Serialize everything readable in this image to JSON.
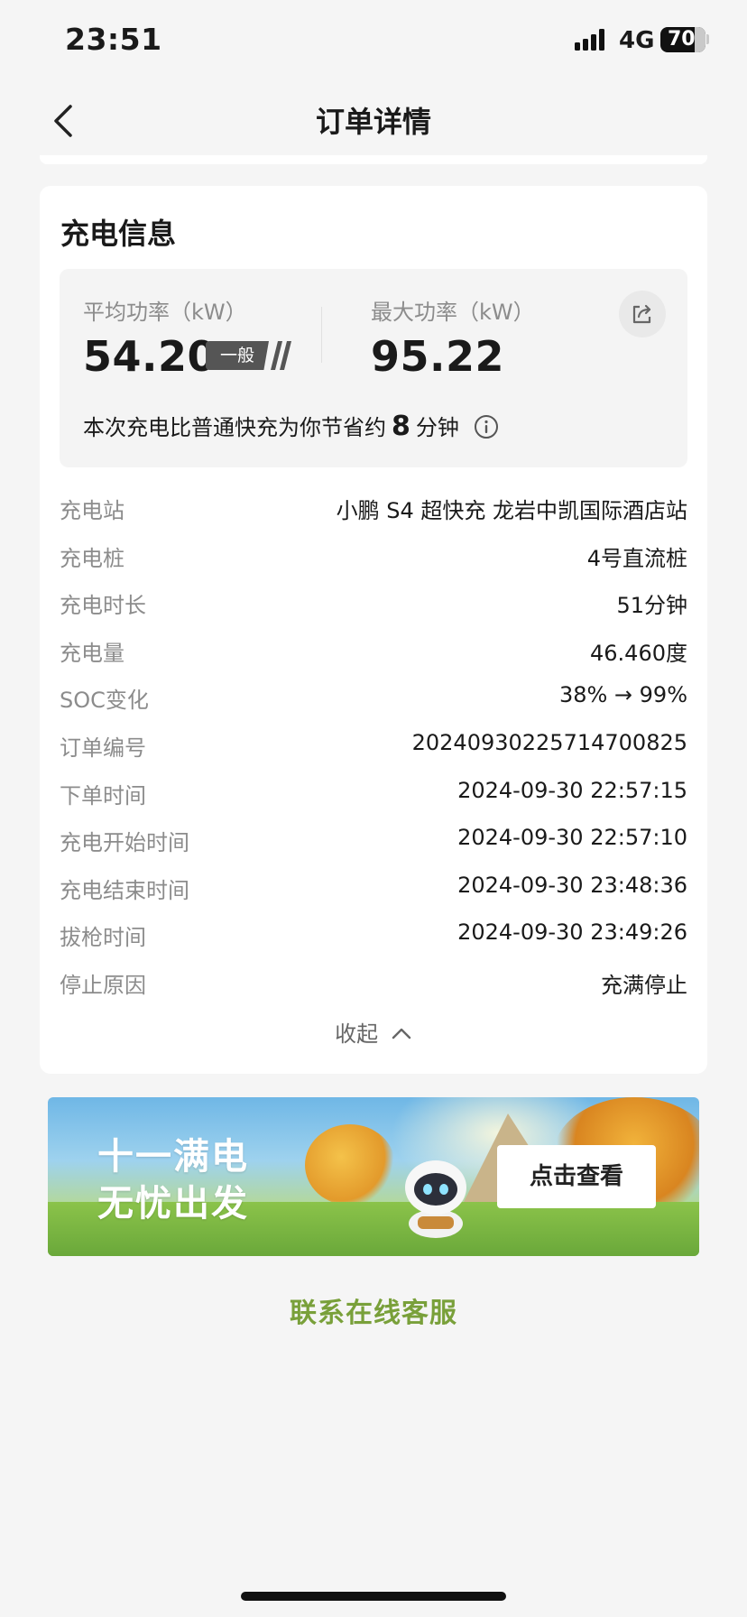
{
  "status_bar": {
    "time": "23:51",
    "network": "4G",
    "battery": "70"
  },
  "nav": {
    "title": "订单详情"
  },
  "charging_info": {
    "title": "充电信息",
    "avg_power_label": "平均功率（kW）",
    "avg_power_value": "54.20",
    "avg_power_level": "一般",
    "max_power_label": "最大功率（kW）",
    "max_power_value": "95.22",
    "saving_prefix": "本次充电比普通快充为你节省约",
    "saving_number": "8",
    "saving_suffix": "分钟",
    "rows": [
      {
        "label": "充电站",
        "value": "小鹏 S4 超快充 龙岩中凯国际酒店站"
      },
      {
        "label": "充电桩",
        "value": "4号直流桩"
      },
      {
        "label": "充电时长",
        "value": "51分钟"
      },
      {
        "label": "充电量",
        "value": "46.460度"
      },
      {
        "label": "SOC变化",
        "value": "38% → 99%"
      },
      {
        "label": "订单编号",
        "value": "20240930225714700825"
      },
      {
        "label": "下单时间",
        "value": "2024-09-30 22:57:15"
      },
      {
        "label": "充电开始时间",
        "value": "2024-09-30 22:57:10"
      },
      {
        "label": "充电结束时间",
        "value": "2024-09-30 23:48:36"
      },
      {
        "label": "拔枪时间",
        "value": "2024-09-30 23:49:26"
      },
      {
        "label": "停止原因",
        "value": "充满停止"
      }
    ],
    "collapse_label": "收起"
  },
  "banner": {
    "line1": "十一满电",
    "line2": "无忧出发",
    "button": "点击查看"
  },
  "service_link": "联系在线客服",
  "colors": {
    "accent_green": "#79a03a",
    "background": "#f5f5f5"
  }
}
